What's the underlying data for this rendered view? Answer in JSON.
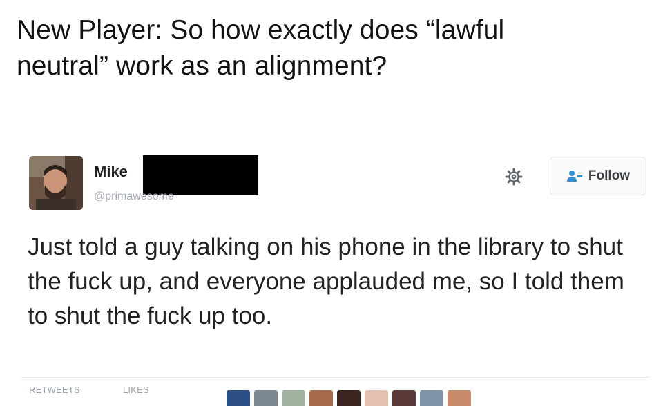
{
  "caption": {
    "line1": "New Player: So how exactly does “lawful",
    "line2": "neutral” work as an alignment?"
  },
  "tweet": {
    "author": {
      "display_name": "Mike",
      "handle": "@primawesome"
    },
    "follow_label": "Follow",
    "text": "Just told a guy talking on his phone in the library to shut the fuck up, and everyone applauded me, so I told them to shut the fuck up too.",
    "stats": {
      "retweets_label": "RETWEETS",
      "likes_label": "LIKES"
    },
    "liker_colors": [
      "#2b4f86",
      "#7b8791",
      "#9fb2a0",
      "#a86a4a",
      "#3b2320",
      "#e6c1b0",
      "#5b3a3a",
      "#7f93a8",
      "#c98a6a"
    ]
  },
  "icons": {
    "gear": "gear-icon",
    "follow": "add-user-icon"
  }
}
